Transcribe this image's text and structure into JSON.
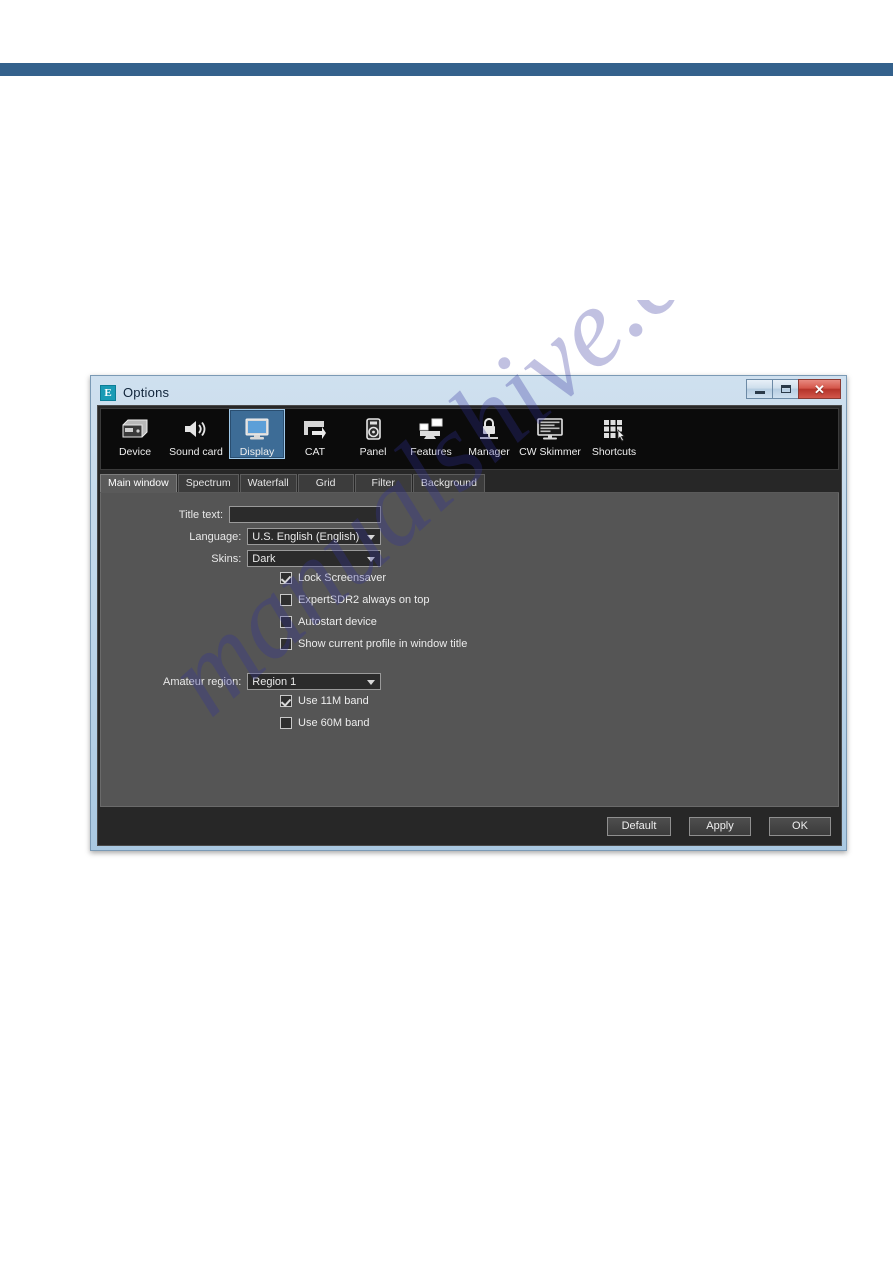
{
  "page": {
    "rule_color": "#34618c",
    "watermark_text": "manualshive.com"
  },
  "dialog": {
    "title": "Options",
    "app_icon_letter": "E",
    "window_controls": {
      "minimize": "minimize-icon",
      "maximize": "maximize-icon",
      "close": "✕"
    }
  },
  "toolbar": {
    "items": [
      {
        "label": "Device",
        "icon": "device-icon",
        "selected": false
      },
      {
        "label": "Sound card",
        "icon": "sound-card-icon",
        "selected": false
      },
      {
        "label": "Display",
        "icon": "display-icon",
        "selected": true
      },
      {
        "label": "CAT",
        "icon": "cat-icon",
        "selected": false
      },
      {
        "label": "Panel",
        "icon": "panel-icon",
        "selected": false
      },
      {
        "label": "Features",
        "icon": "features-icon",
        "selected": false
      },
      {
        "label": "Manager",
        "icon": "manager-lock-icon",
        "selected": false
      },
      {
        "label": "CW Skimmer",
        "icon": "cw-skimmer-icon",
        "selected": false
      },
      {
        "label": "Shortcuts",
        "icon": "shortcuts-icon",
        "selected": false
      }
    ]
  },
  "tabs": [
    {
      "label": "Main window",
      "active": true
    },
    {
      "label": "Spectrum",
      "active": false
    },
    {
      "label": "Waterfall",
      "active": false
    },
    {
      "label": "Grid",
      "active": false
    },
    {
      "label": "Filter",
      "active": false
    },
    {
      "label": "Background",
      "active": false
    }
  ],
  "form": {
    "title_text": {
      "label": "Title text:",
      "value": "",
      "placeholder": ""
    },
    "language": {
      "label": "Language:",
      "value": "U.S. English (English)"
    },
    "skins": {
      "label": "Skins:",
      "value": "Dark"
    },
    "checkboxes": [
      {
        "label": "Lock Screensaver",
        "checked": true
      },
      {
        "label": "ExpertSDR2 always on top",
        "checked": false
      },
      {
        "label": "Autostart device",
        "checked": false
      },
      {
        "label": "Show current profile in window title",
        "checked": false
      }
    ],
    "amateur_region": {
      "label": "Amateur region:",
      "value": "Region 1"
    },
    "band_checkboxes": [
      {
        "label": "Use 11M band",
        "checked": true
      },
      {
        "label": "Use 60M band",
        "checked": false
      }
    ]
  },
  "footer": {
    "default_label": "Default",
    "apply_label": "Apply",
    "ok_label": "OK"
  }
}
